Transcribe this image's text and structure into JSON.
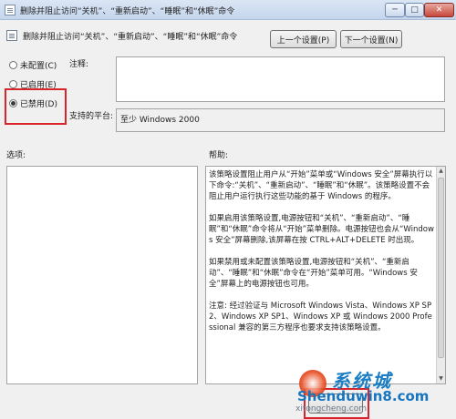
{
  "window": {
    "title": "删除并阻止访问“关机”、“重新启动”、“睡眠”和“休眠”命令",
    "min_glyph": "─",
    "max_glyph": "□",
    "close_glyph": "✕"
  },
  "header": {
    "title": "删除并阻止访问“关机”、“重新启动”、“睡眠”和“休眠”命令",
    "prev_label": "上一个设置(P)",
    "next_label": "下一个设置(N)"
  },
  "state": {
    "options": [
      {
        "label": "未配置(C)",
        "selected": false
      },
      {
        "label": "已启用(E)",
        "selected": false
      },
      {
        "label": "已禁用(D)",
        "selected": true
      }
    ]
  },
  "comment": {
    "label": "注释:",
    "value": ""
  },
  "platform": {
    "label": "支持的平台:",
    "value": "至少 Windows 2000"
  },
  "options_section": {
    "label": "选项:"
  },
  "help_section": {
    "label": "帮助:",
    "paragraphs": [
      "该策略设置阻止用户从“开始”菜单或“Windows 安全”屏幕执行以下命令:“关机”、“重新启动”、“睡眠”和“休眠”。该策略设置不会阻止用户运行执行这些功能的基于 Windows 的程序。",
      "如果启用该策略设置,电源按钮和“关机”、“重新启动”、“睡眠”和“休眠”命令将从“开始”菜单删除。电源按钮也会从“Windows 安全”屏幕删除,该屏幕在按 CTRL+ALT+DELETE 时出现。",
      "如果禁用或未配置该策略设置,电源按钮和“关机”、“重新启动”、“睡眠”和“休眠”命令在“开始”菜单可用。“Windows 安全”屏幕上的电源按钮也可用。",
      "注意: 经过验证与 Microsoft Windows Vista、Windows XP SP2、Windows XP SP1、Windows XP 或 Windows 2000 Professional 兼容的第三方程序也要求支持该策略设置。"
    ]
  },
  "watermark": {
    "cn": "系统城",
    "main": "Shenduwin8.com",
    "sub": "xitongcheng.com"
  },
  "colors": {
    "highlight": "#d8242b",
    "titlebar": "#c4d5ec"
  }
}
